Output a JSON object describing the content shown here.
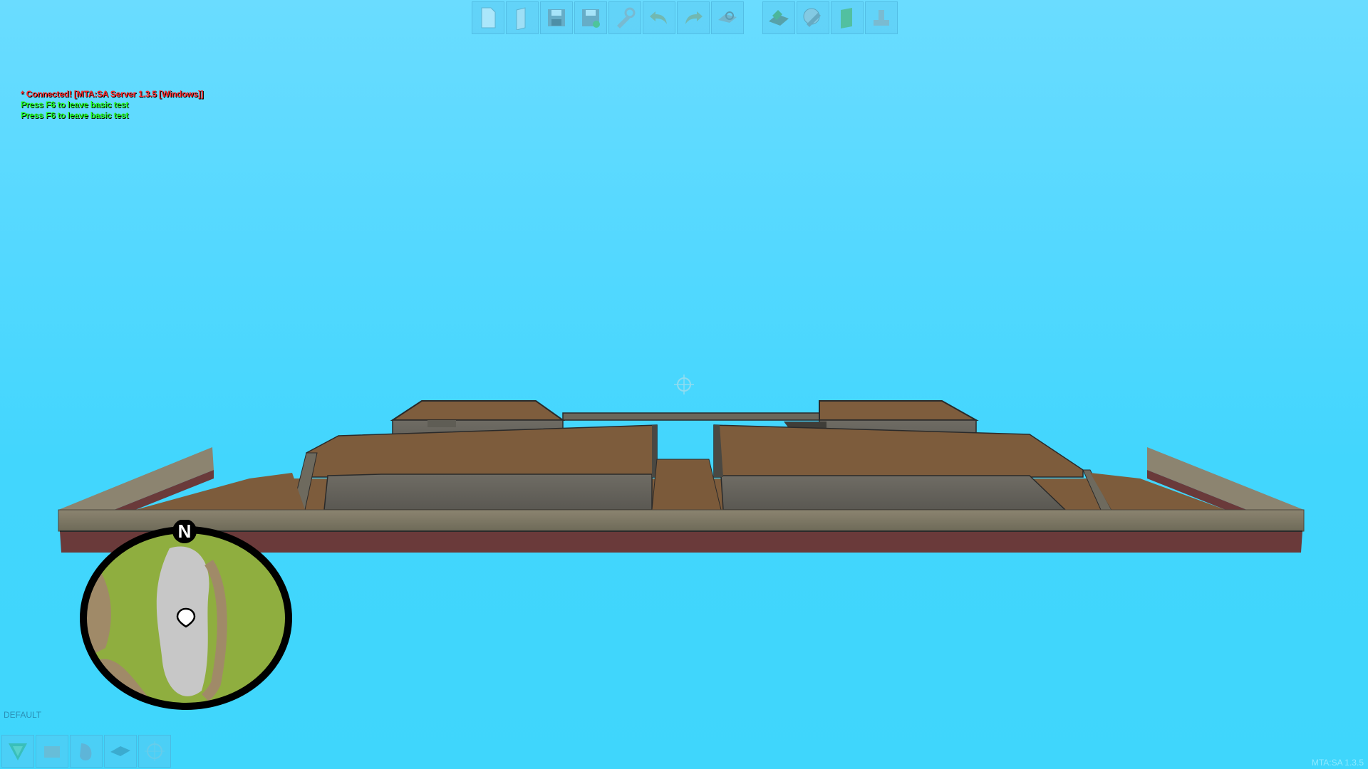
{
  "toolbar": {
    "groups": [
      [
        "new-icon",
        "open-icon",
        "save-icon",
        "save-as-icon",
        "options-icon",
        "undo-icon",
        "redo-icon",
        "locations-icon"
      ],
      [
        "test-icon",
        "map-settings-icon",
        "definitions-icon",
        "current-elements-icon"
      ]
    ]
  },
  "chat": {
    "lines": [
      {
        "text": "* Connected! [MTA:SA Server 1.3.5 [Windows]]",
        "color": "#ff2a2a"
      },
      {
        "text": "Press F6 to leave basic test",
        "color": "#22ff22"
      },
      {
        "text": "Press F6 to leave basic test",
        "color": "#22ff22"
      }
    ]
  },
  "radar": {
    "north_label": "N"
  },
  "status": {
    "mode": "DEFAULT",
    "version": "MTA:SA 1.3.5"
  },
  "bottom_toolbar": {
    "items": [
      "objects-icon",
      "vehicles-icon",
      "peds-icon",
      "markers-icon",
      "crosshair-tool-icon"
    ]
  },
  "colors": {
    "sky": "#42d6fd",
    "wood": "#7a5a3a",
    "stone": "#6e6a5e",
    "red_base": "#6a3a3a"
  }
}
